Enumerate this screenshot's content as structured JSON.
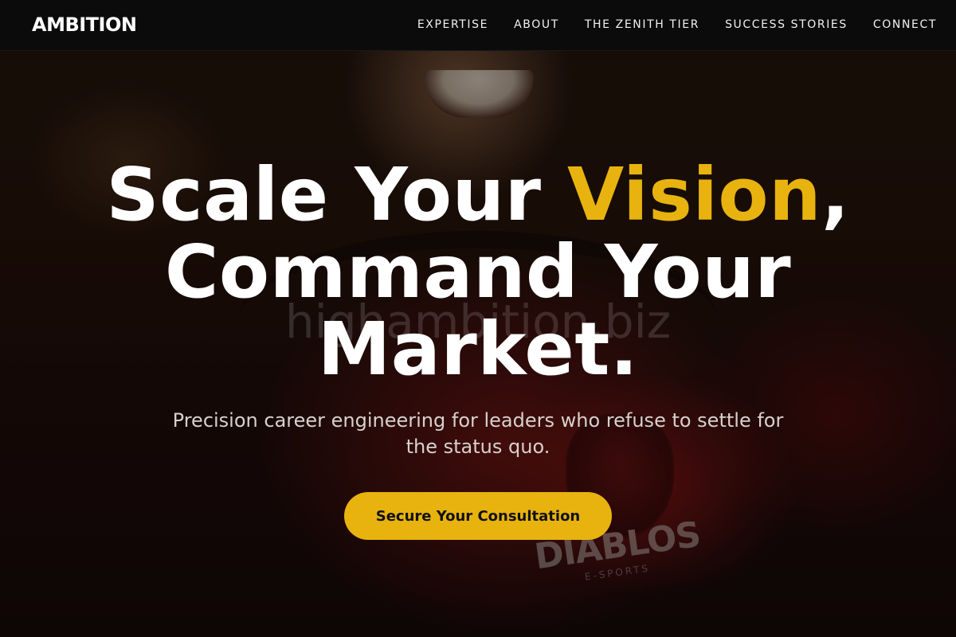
{
  "nav": {
    "brand": "AMBITION",
    "links": [
      {
        "label": "EXPERTISE"
      },
      {
        "label": "ABOUT"
      },
      {
        "label": "THE ZENITH TIER"
      },
      {
        "label": "SUCCESS STORIES"
      },
      {
        "label": "CONNECT"
      }
    ]
  },
  "hero": {
    "title_part1": "Scale Your ",
    "title_accent": "Vision",
    "title_part2": ", Command Your Market.",
    "subtitle": "Precision career engineering for leaders who refuse to settle for the status quo.",
    "cta_label": "Secure Your Consultation",
    "watermark": "highambition.biz",
    "background_logo_text": "DIABLOS",
    "background_logo_sub": "E-SPORTS"
  },
  "colors": {
    "accent": "#e8b30f",
    "nav_bg": "#0b0b0b",
    "text": "#ffffff"
  }
}
